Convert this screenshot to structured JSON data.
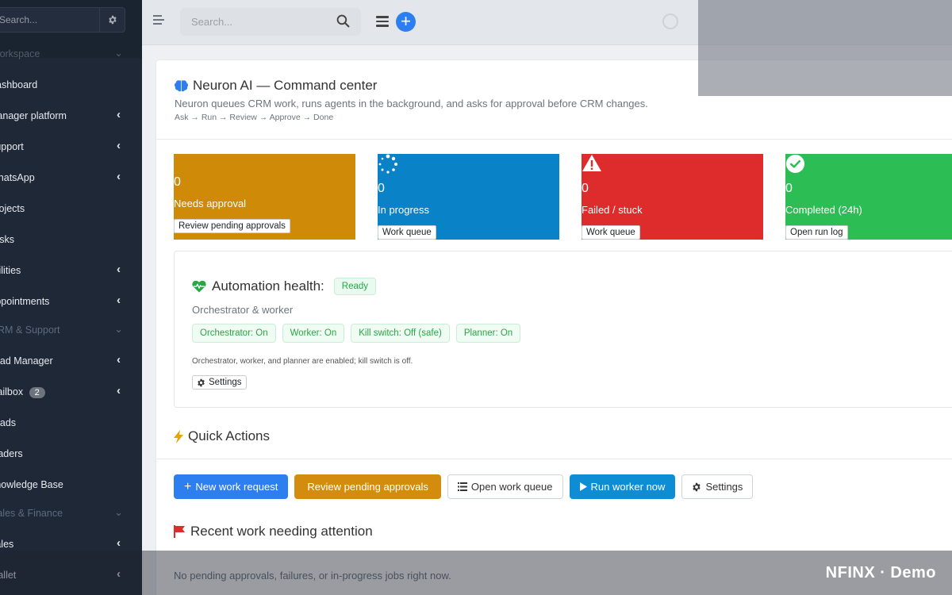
{
  "sidebar": {
    "search_placeholder": "Search...",
    "sections": [
      {
        "label": "Workspace"
      },
      {
        "label": "CRM & Support"
      },
      {
        "label": "Sales & Finance"
      }
    ],
    "items": [
      {
        "label": "Dashboard",
        "has_submenu": false
      },
      {
        "label": "Manager platform",
        "has_submenu": true
      },
      {
        "label": "Support",
        "has_submenu": true
      },
      {
        "label": "WhatsApp",
        "has_submenu": true
      },
      {
        "label": "Projects",
        "has_submenu": false
      },
      {
        "label": "Tasks",
        "has_submenu": false
      },
      {
        "label": "Utilities",
        "has_submenu": true
      },
      {
        "label": "Appointments",
        "has_submenu": true
      },
      {
        "label": "Lead Manager",
        "has_submenu": true
      },
      {
        "label": "Mailbox",
        "has_submenu": true,
        "badge": "2"
      },
      {
        "label": "Leads",
        "has_submenu": false
      },
      {
        "label": "Traders",
        "has_submenu": false
      },
      {
        "label": "Knowledge Base",
        "has_submenu": false
      },
      {
        "label": "Sales",
        "has_submenu": true
      },
      {
        "label": "Wallet",
        "has_submenu": true
      }
    ]
  },
  "topbar": {
    "search_placeholder": "Search..."
  },
  "header": {
    "title": "Neuron AI — Command center",
    "subtitle": "Neuron queues CRM work, runs agents in the background, and asks for approval before CRM changes.",
    "flow": "Ask → Run → Review → Approve → Done"
  },
  "tiles": [
    {
      "count": "0",
      "label": "Needs approval",
      "button": "Review pending approvals",
      "color": "#cf8a08",
      "icon": "none"
    },
    {
      "count": "0",
      "label": "In progress",
      "button": "Work queue",
      "color": "#0a82c8",
      "icon": "spinner-icon"
    },
    {
      "count": "0",
      "label": "Failed / stuck",
      "button": "Work queue",
      "color": "#de2b2b",
      "icon": "warning-icon"
    },
    {
      "count": "0",
      "label": "Completed (24h)",
      "button": "Open run log",
      "color": "#2cbe55",
      "icon": "check-circle-icon"
    }
  ],
  "health": {
    "title": "Automation health:",
    "status": "Ready",
    "subtitle": "Orchestrator & worker",
    "chips": [
      "Orchestrator: On",
      "Worker: On",
      "Kill switch: Off (safe)",
      "Planner: On"
    ],
    "note": "Orchestrator, worker, and planner are enabled; kill switch is off.",
    "settings_label": "Settings",
    "accent": "#28a745"
  },
  "quick_actions": {
    "title": "Quick Actions",
    "buttons": [
      {
        "label": "New work request",
        "icon": "plus-icon"
      },
      {
        "label": "Review pending approvals",
        "icon": "none"
      },
      {
        "label": "Open work queue",
        "icon": "list-icon"
      },
      {
        "label": "Run worker now",
        "icon": "play-icon"
      },
      {
        "label": "Settings",
        "icon": "gear-icon"
      }
    ]
  },
  "recent": {
    "title": "Recent work needing attention",
    "empty": "No pending approvals, failures, or in-progress jobs right now."
  },
  "brand": {
    "watermark": "NFINX · Demo"
  },
  "colors": {
    "primary": "#2d7ff0",
    "warning": "#d48c0f",
    "info": "#0f8dd4",
    "success": "#28a745",
    "danger": "#de2b2b",
    "sidebar_bg": "#1e2837"
  }
}
